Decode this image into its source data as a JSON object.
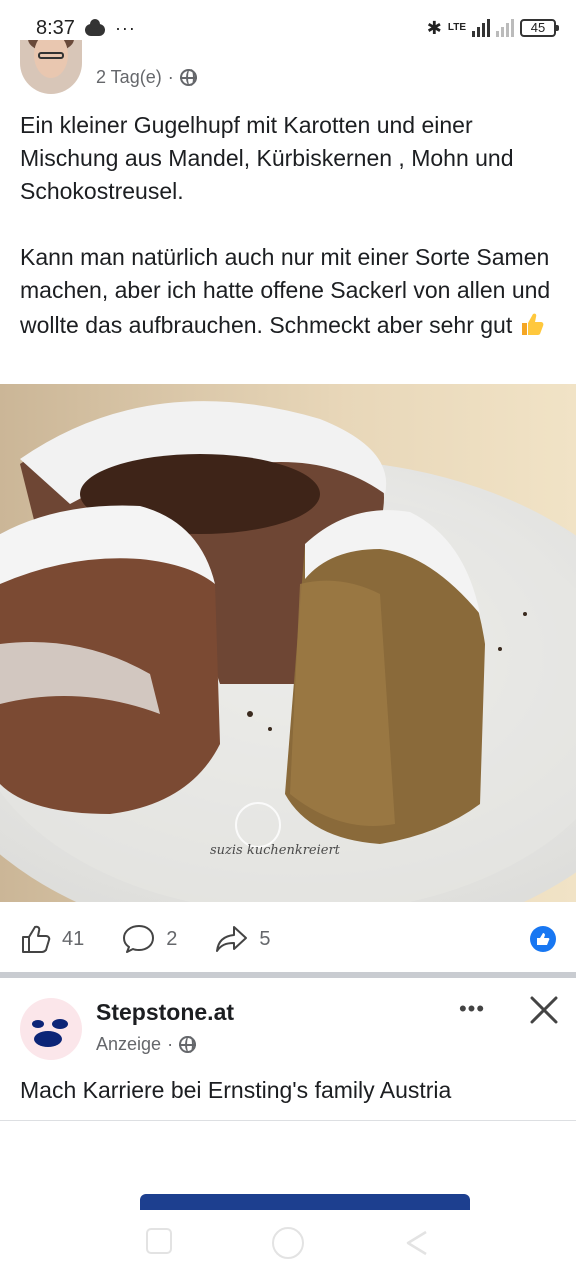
{
  "status_bar": {
    "time": "8:37",
    "more": "···",
    "network": "LTE",
    "battery": "45"
  },
  "post": {
    "time_ago": "2 Tag(e)",
    "paragraph_1": "Ein kleiner Gugelhupf mit Karotten und einer Mischung aus Mandel, Kürbiskernen , Mohn und Schokostreusel.",
    "paragraph_2": "Kann man natürlich auch nur mit einer Sorte Samen machen, aber ich hatte offene Sackerl von allen und wollte das aufbrauchen. Schmeckt aber sehr gut",
    "watermark": "suzis kuchenkreiert",
    "reactions": {
      "likes": "41",
      "comments": "2",
      "shares": "5"
    }
  },
  "ad": {
    "name": "Stepstone.at",
    "label": "Anzeige",
    "more": "•••",
    "text": "Mach Karriere bei Ernsting's family Austria"
  },
  "icons": {
    "status": [
      "cloud-icon",
      "bluetooth-icon",
      "signal-icon",
      "battery-icon"
    ],
    "post": [
      "globe-icon",
      "thumbs-up-emoji-icon",
      "like-icon",
      "comment-icon",
      "share-icon",
      "like-badge-icon"
    ],
    "ad": [
      "globe-icon",
      "more-icon",
      "close-icon"
    ],
    "nav": [
      "recent-apps-icon",
      "home-icon",
      "back-icon"
    ]
  },
  "colors": {
    "facebook_blue": "#1877f2",
    "text": "#1c1e21",
    "secondary_text": "#65676b",
    "divider": "#c9ccd1"
  }
}
